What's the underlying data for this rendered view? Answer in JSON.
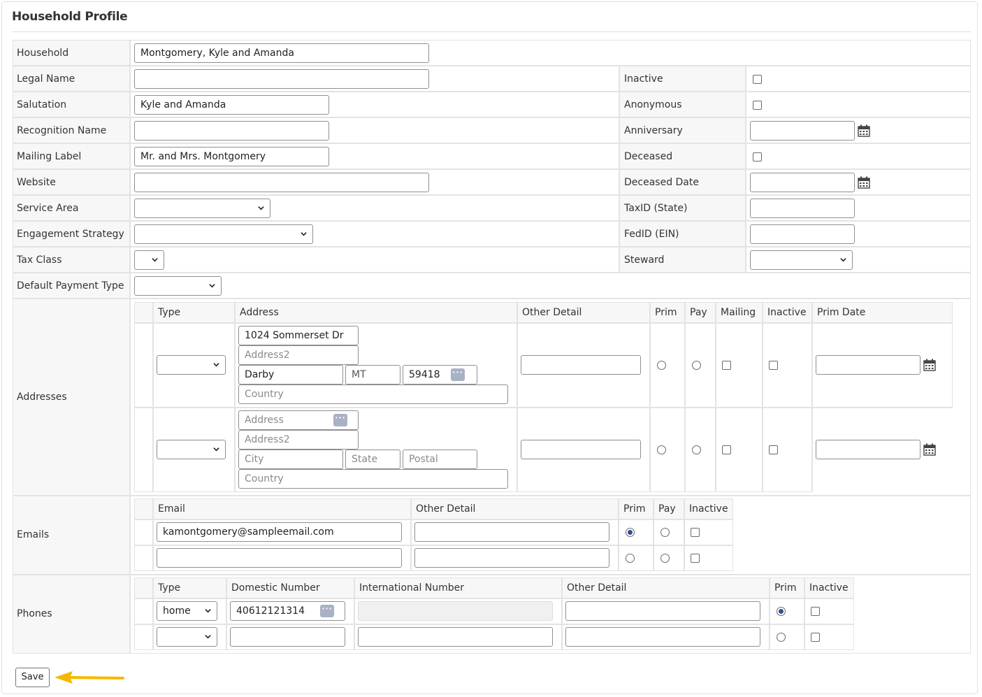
{
  "page": {
    "title": "Household Profile"
  },
  "left_fields": {
    "household": {
      "label": "Household",
      "value": "Montgomery, Kyle and Amanda"
    },
    "legal_name": {
      "label": "Legal Name",
      "value": ""
    },
    "salutation": {
      "label": "Salutation",
      "value": "Kyle and Amanda"
    },
    "recognition_name": {
      "label": "Recognition Name",
      "value": ""
    },
    "mailing_label": {
      "label": "Mailing Label",
      "value": "Mr. and Mrs. Montgomery"
    },
    "website": {
      "label": "Website",
      "value": ""
    },
    "service_area": {
      "label": "Service Area",
      "value": ""
    },
    "engagement_strategy": {
      "label": "Engagement Strategy",
      "value": ""
    },
    "tax_class": {
      "label": "Tax Class",
      "value": ""
    },
    "default_payment_type": {
      "label": "Default Payment Type",
      "value": ""
    }
  },
  "right_fields": {
    "inactive": {
      "label": "Inactive",
      "checked": false
    },
    "anonymous": {
      "label": "Anonymous",
      "checked": false
    },
    "anniversary": {
      "label": "Anniversary",
      "value": ""
    },
    "deceased": {
      "label": "Deceased",
      "checked": false
    },
    "deceased_date": {
      "label": "Deceased Date",
      "value": ""
    },
    "taxid_state": {
      "label": "TaxID (State)",
      "value": ""
    },
    "fedid": {
      "label": "FedID (EIN)",
      "value": ""
    },
    "steward": {
      "label": "Steward",
      "value": ""
    }
  },
  "addresses": {
    "label": "Addresses",
    "columns": [
      "Type",
      "Address",
      "Other Detail",
      "Prim",
      "Pay",
      "Mailing",
      "Inactive",
      "Prim Date"
    ],
    "rows": [
      {
        "type": "",
        "address1": "1024 Sommerset Dr",
        "address2": "",
        "city": "Darby",
        "state": "MT",
        "postal": "59418",
        "country": "",
        "other_detail": "",
        "prim": false,
        "pay": false,
        "mailing": false,
        "inactive": false,
        "prim_date": ""
      },
      {
        "type": "",
        "address1": "",
        "address2": "",
        "city": "",
        "state": "",
        "postal": "",
        "country": "",
        "other_detail": "",
        "prim": false,
        "pay": false,
        "mailing": false,
        "inactive": false,
        "prim_date": ""
      }
    ],
    "placeholders": {
      "address1": "Address",
      "address2": "Address2",
      "city": "City",
      "state": "State",
      "postal": "Postal",
      "country": "Country"
    }
  },
  "emails": {
    "label": "Emails",
    "columns": [
      "Email",
      "Other Detail",
      "Prim",
      "Pay",
      "Inactive"
    ],
    "rows": [
      {
        "email": "kamontgomery@sampleemail.com",
        "other_detail": "",
        "prim": true,
        "pay": false,
        "inactive": false
      },
      {
        "email": "",
        "other_detail": "",
        "prim": false,
        "pay": false,
        "inactive": false
      }
    ]
  },
  "phones": {
    "label": "Phones",
    "columns": [
      "Type",
      "Domestic Number",
      "International Number",
      "Other Detail",
      "Prim",
      "Inactive"
    ],
    "rows": [
      {
        "type": "home",
        "domestic": "40612121314",
        "international": "",
        "other_detail": "",
        "prim": true,
        "inactive": false
      },
      {
        "type": "",
        "domestic": "",
        "international": "",
        "other_detail": "",
        "prim": false,
        "inactive": false
      }
    ]
  },
  "actions": {
    "save_label": "Save"
  },
  "colors": {
    "annotation_arrow": "#f5b800",
    "radio_selected": "#2f4f8f"
  },
  "icons": {
    "calendar": "calendar-icon",
    "lookup": "ellipsis-lookup-icon",
    "chevron": "chevron-down-icon"
  }
}
